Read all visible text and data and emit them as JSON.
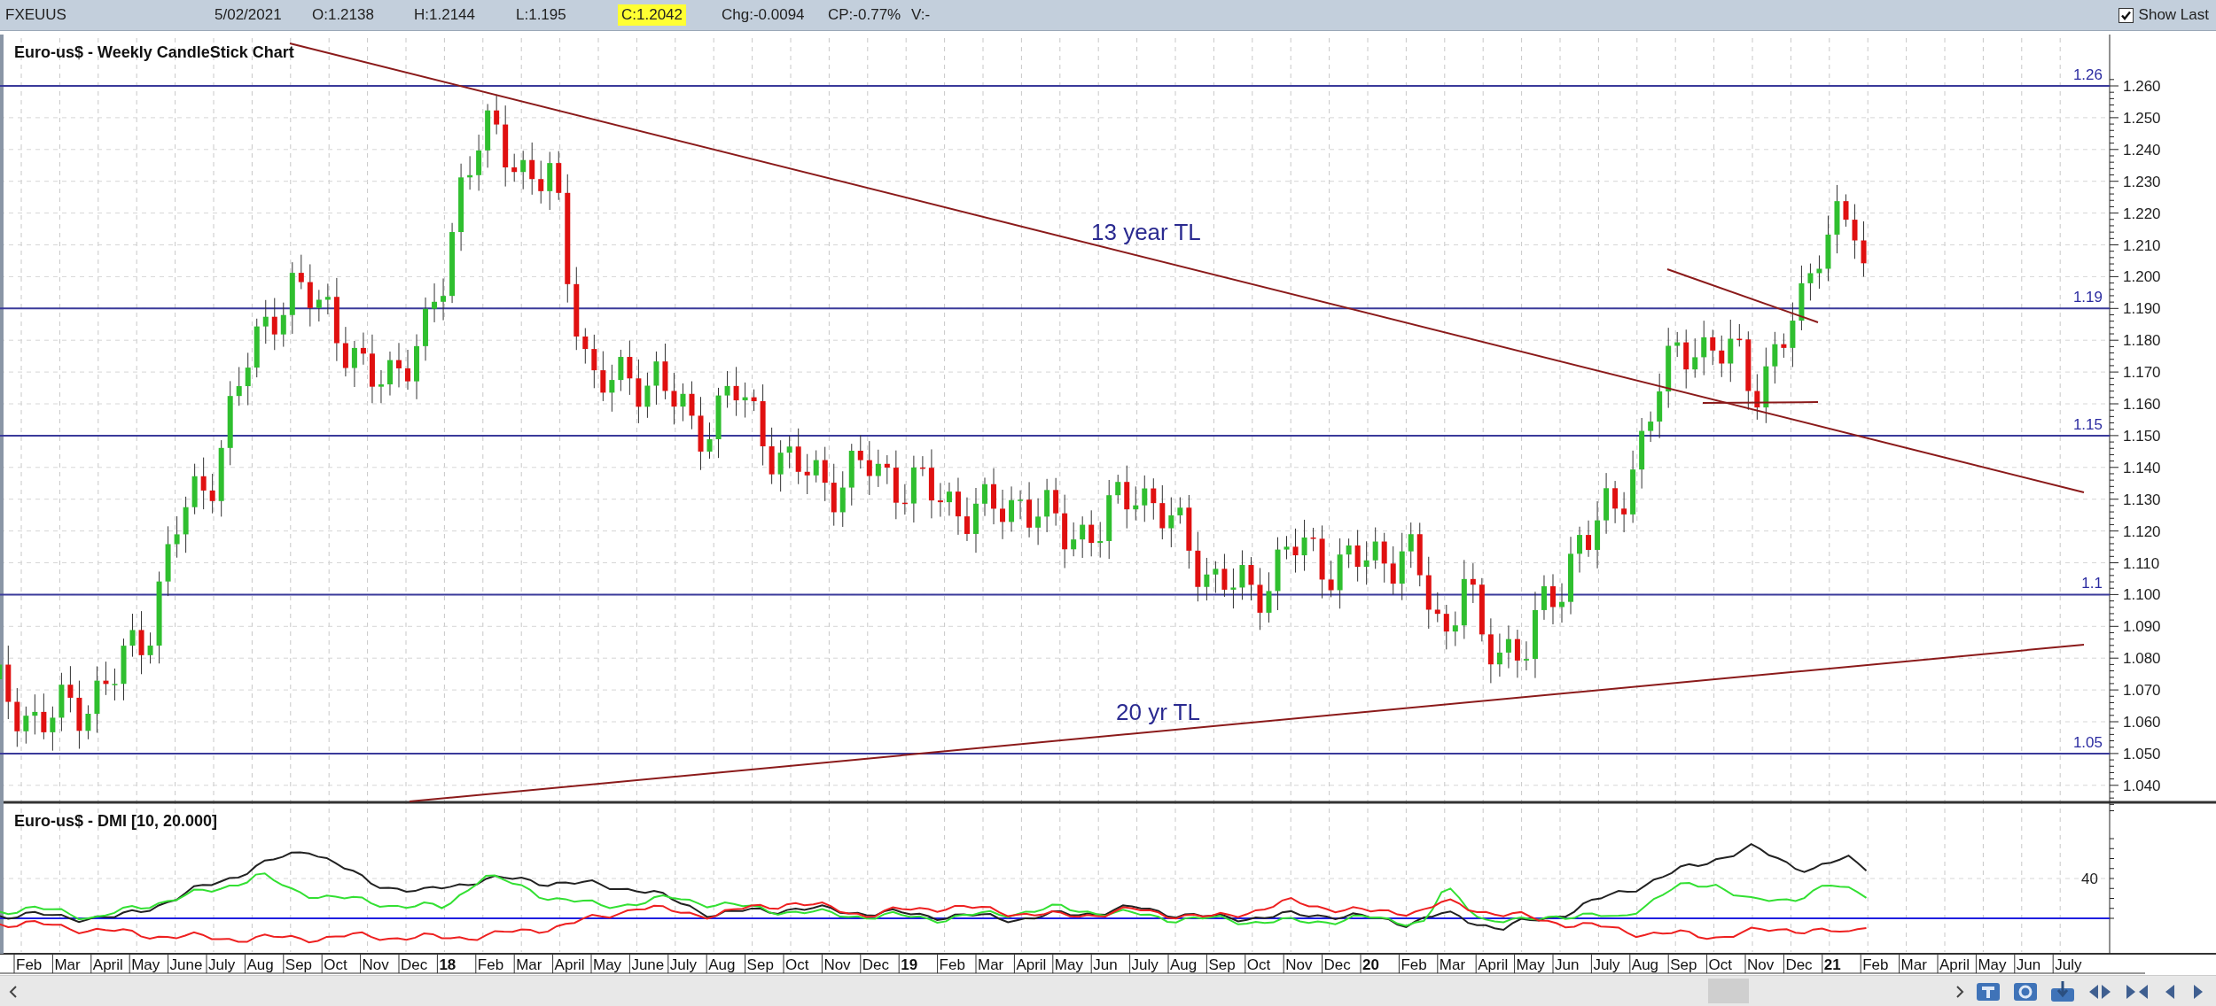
{
  "symbol_bar": {
    "symbol": "FXEUUS",
    "date": "5/02/2021",
    "open": "O:1.2138",
    "high": "H:1.2144",
    "low": "L:1.195",
    "close": "C:1.2042",
    "change": "Chg:-0.0094",
    "change_percent": "CP:-0.77%",
    "volume": "V:-",
    "show_last": {
      "label": "Show Last",
      "checked": true
    }
  },
  "price_chart": {
    "title": "Euro-us$ - Weekly CandleStick Chart",
    "y_axis_labels": [
      "1.260",
      "1.250",
      "1.240",
      "1.230",
      "1.220",
      "1.210",
      "1.200",
      "1.190",
      "1.180",
      "1.170",
      "1.160",
      "1.150",
      "1.140",
      "1.130",
      "1.120",
      "1.110",
      "1.100",
      "1.090",
      "1.080",
      "1.070",
      "1.060",
      "1.050",
      "1.040"
    ],
    "levels": [
      {
        "label": "1.26"
      },
      {
        "label": "1.19"
      },
      {
        "label": "1.15"
      },
      {
        "label": "1.1"
      },
      {
        "label": "1.05"
      }
    ],
    "trendline_labels": [
      "13 year TL",
      "20 yr TL"
    ]
  },
  "indicator_chart": {
    "title": "Euro-us$ - DMI [10, 20.000]",
    "y_axis_labels": [
      "40"
    ]
  },
  "time_axis": [
    {
      "label": "Feb",
      "kind": "month"
    },
    {
      "label": "Mar",
      "kind": "month"
    },
    {
      "label": "April",
      "kind": "month"
    },
    {
      "label": "May",
      "kind": "month"
    },
    {
      "label": "June",
      "kind": "month"
    },
    {
      "label": "July",
      "kind": "month"
    },
    {
      "label": "Aug",
      "kind": "month"
    },
    {
      "label": "Sep",
      "kind": "month"
    },
    {
      "label": "Oct",
      "kind": "month"
    },
    {
      "label": "Nov",
      "kind": "month"
    },
    {
      "label": "Dec",
      "kind": "month"
    },
    {
      "label": "18",
      "kind": "year"
    },
    {
      "label": "Feb",
      "kind": "month"
    },
    {
      "label": "Mar",
      "kind": "month"
    },
    {
      "label": "April",
      "kind": "month"
    },
    {
      "label": "May",
      "kind": "month"
    },
    {
      "label": "June",
      "kind": "month"
    },
    {
      "label": "July",
      "kind": "month"
    },
    {
      "label": "Aug",
      "kind": "month"
    },
    {
      "label": "Sep",
      "kind": "month"
    },
    {
      "label": "Oct",
      "kind": "month"
    },
    {
      "label": "Nov",
      "kind": "month"
    },
    {
      "label": "Dec",
      "kind": "month"
    },
    {
      "label": "19",
      "kind": "year"
    },
    {
      "label": "Feb",
      "kind": "month"
    },
    {
      "label": "Mar",
      "kind": "month"
    },
    {
      "label": "April",
      "kind": "month"
    },
    {
      "label": "May",
      "kind": "month"
    },
    {
      "label": "Jun",
      "kind": "month"
    },
    {
      "label": "July",
      "kind": "month"
    },
    {
      "label": "Aug",
      "kind": "month"
    },
    {
      "label": "Sep",
      "kind": "month"
    },
    {
      "label": "Oct",
      "kind": "month"
    },
    {
      "label": "Nov",
      "kind": "month"
    },
    {
      "label": "Dec",
      "kind": "month"
    },
    {
      "label": "20",
      "kind": "year"
    },
    {
      "label": "Feb",
      "kind": "month"
    },
    {
      "label": "Mar",
      "kind": "month"
    },
    {
      "label": "April",
      "kind": "month"
    },
    {
      "label": "May",
      "kind": "month"
    },
    {
      "label": "Jun",
      "kind": "month"
    },
    {
      "label": "July",
      "kind": "month"
    },
    {
      "label": "Aug",
      "kind": "month"
    },
    {
      "label": "Sep",
      "kind": "month"
    },
    {
      "label": "Oct",
      "kind": "month"
    },
    {
      "label": "Nov",
      "kind": "month"
    },
    {
      "label": "Dec",
      "kind": "month"
    },
    {
      "label": "21",
      "kind": "year"
    },
    {
      "label": "Feb",
      "kind": "month"
    },
    {
      "label": "Mar",
      "kind": "month"
    },
    {
      "label": "April",
      "kind": "month"
    },
    {
      "label": "May",
      "kind": "month"
    },
    {
      "label": "Jun",
      "kind": "month"
    },
    {
      "label": "July",
      "kind": "month"
    }
  ]
}
